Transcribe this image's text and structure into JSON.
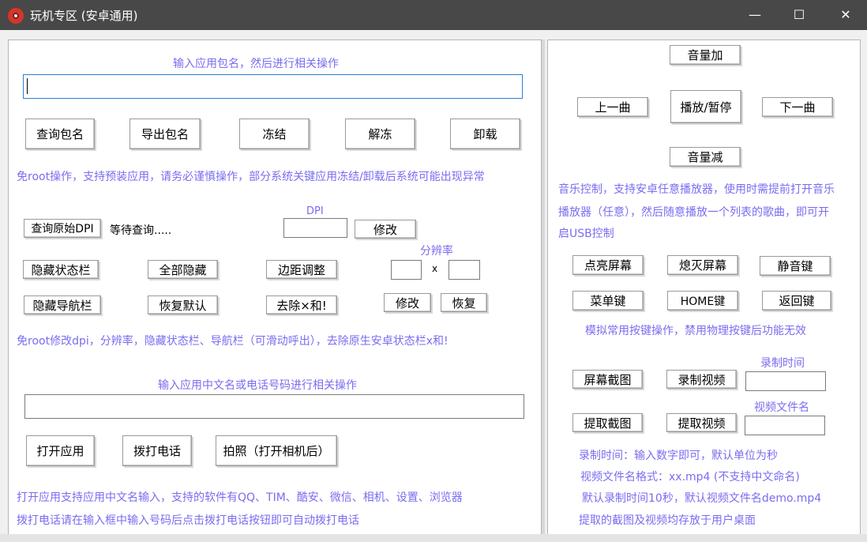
{
  "window": {
    "title": "玩机专区 (安卓通用)",
    "minimize": "—",
    "maximize": "☐",
    "close": "✕",
    "app_icon": "app-logo-icon"
  },
  "left": {
    "pkg_hint": "输入应用包名，然后进行相关操作",
    "pkg_value": "",
    "buttons1": [
      "查询包名",
      "导出包名",
      "冻结",
      "解冻",
      "卸载"
    ],
    "warn1": "免root操作，支持预装应用，请务必谨慎操作，部分系统关键应用冻结/卸载后系统可能出现异常",
    "query_dpi": "查询原始DPI",
    "dpi_status": "等待查询.....",
    "dpi_label": "DPI",
    "dpi_value": "",
    "modify": "修改",
    "res_label": "分辨率",
    "res_x": "x",
    "res_w": "",
    "res_h": "",
    "row_a": [
      "隐藏状态栏",
      "全部隐藏",
      "边距调整"
    ],
    "row_b": [
      "隐藏导航栏",
      "恢复默认",
      "去除×和!"
    ],
    "res_modify": "修改",
    "res_restore": "恢复",
    "warn2": "免root修改dpi，分辨率，隐藏状态栏、导航栏（可滑动呼出），去除原生安卓状态栏x和!",
    "name_hint": "输入应用中文名或电话号码进行相关操作",
    "name_value": "",
    "buttons3": [
      "打开应用",
      "拨打电话",
      "拍照（打开相机后）"
    ],
    "info1": "打开应用支持应用中文名输入，支持的软件有QQ、TIM、酷安、微信、相机、设置、浏览器",
    "info2": "拨打电话请在输入框中输入号码后点击拨打电话按钮即可自动拨打电话"
  },
  "right": {
    "vol_up": "音量加",
    "prev": "上一曲",
    "play_pause": "播放/暂停",
    "next": "下一曲",
    "vol_down": "音量减",
    "music_info1": "音乐控制，支持安卓任意播放器，使用时需提前打开音乐",
    "music_info2": "播放器（任意），然后随意播放一个列表的歌曲，即可开",
    "music_info3": "启USB控制",
    "keys_row1": [
      "点亮屏幕",
      "熄灭屏幕",
      "静音键"
    ],
    "keys_row2": [
      "菜单键",
      "HOME键",
      "返回键"
    ],
    "keys_info": "模拟常用按键操作，禁用物理按键后功能无效",
    "rec_time_label": "录制时间",
    "screenshot": "屏幕截图",
    "record_video": "录制视频",
    "rec_time_value": "",
    "video_name_label": "视频文件名",
    "extract_screenshot": "提取截图",
    "extract_video": "提取视频",
    "video_name_value": "",
    "notes": [
      "录制时间：输入数字即可，默认单位为秒",
      "视频文件名格式：xx.mp4 (不支持中文命名)",
      "默认录制时间10秒，默认视频文件名demo.mp4",
      "提取的截图及视频均存放于用户桌面"
    ]
  },
  "colors": {
    "hint": "#7a6cf0",
    "titlebar": "#484848",
    "focus_border": "#2a7fd4"
  }
}
